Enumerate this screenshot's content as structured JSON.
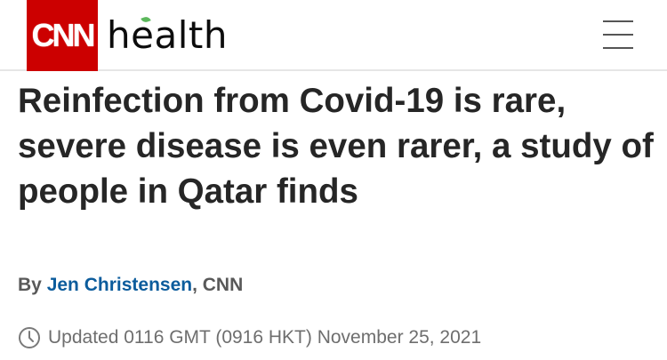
{
  "header": {
    "logo_text": "CNN",
    "section_name": "health",
    "brand_color": "#cc0000",
    "menu_icon": "hamburger-menu-icon"
  },
  "article": {
    "headline": "Reinfection from Covid-19 is rare, severe disease is even rarer, a study of people in Qatar finds",
    "byline_prefix": "By",
    "author": "Jen Christensen",
    "byline_suffix": ", CNN",
    "author_link_color": "#0c5c9c",
    "timestamp_icon": "clock-icon",
    "timestamp": "Updated 0116 GMT (0916 HKT) November 25, 2021"
  }
}
